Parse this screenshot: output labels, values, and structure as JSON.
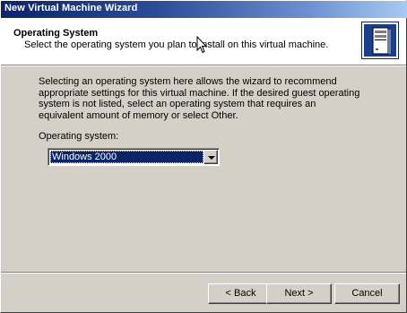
{
  "window": {
    "title": "New Virtual Machine Wizard"
  },
  "header": {
    "title": "Operating System",
    "subtitle": "Select the operating system you plan to install on this virtual machine.",
    "icon": "computer-tower-icon"
  },
  "main": {
    "description": "Selecting an operating system here allows the wizard to recommend appropriate settings for this virtual machine. If the desired guest operating system is not listed, select an operating system that requires an equivalent amount of memory or select Other.",
    "os_label": "Operating system:",
    "os_selected": "Windows 2000"
  },
  "footer": {
    "back_label": "< Back",
    "next_label": "Next >",
    "cancel_label": "Cancel"
  },
  "colors": {
    "title_bar_start": "#0a246a",
    "title_bar_end": "#a6caf0",
    "dialog_bg": "#d4d0c8",
    "selection": "#0a246a"
  }
}
